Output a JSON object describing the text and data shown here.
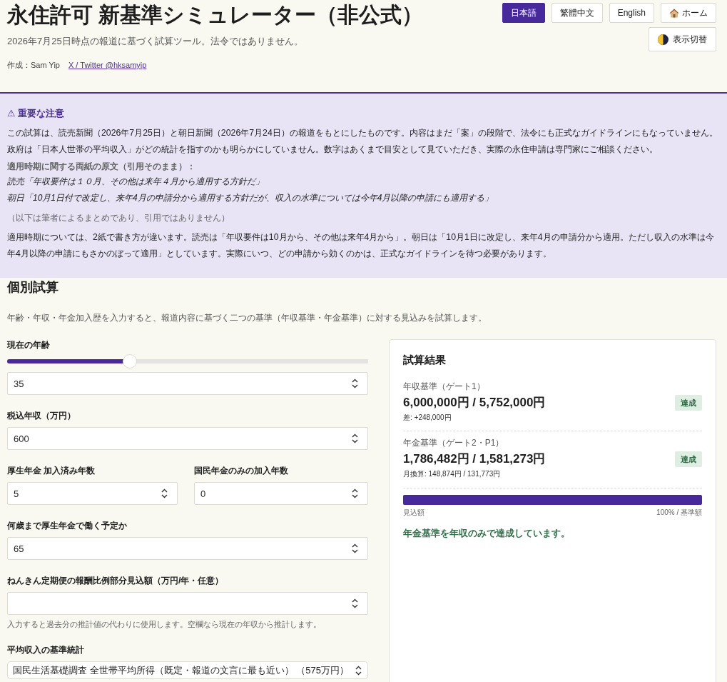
{
  "header": {
    "title": "永住許可 新基準シミュレーター（非公式）",
    "subtitle": "2026年7月25日時点の報道に基づく試算ツール。法令ではありません。",
    "author": "作成：Sam Yip",
    "link": "X / Twitter @hksamyip",
    "languages": [
      {
        "label": "日本語",
        "selected": true
      },
      {
        "label": "繁體中文",
        "selected": false
      },
      {
        "label": "English",
        "selected": false
      }
    ],
    "home_button": {
      "label": "ホーム"
    },
    "theme_button": {
      "label": "表示切替"
    }
  },
  "notice": {
    "title": "⚠ 重要な注意",
    "paragraph": "この試算は、読売新聞（2026年7月25日）と朝日新聞（2026年7月24日）の報道をもとにしたものです。内容はまだ「案」の段階で、法令にも正式なガイドラインにもなっていません。政府は「日本人世帯の平均収入」がどの統計を指すのかも明らかにしていません。数字はあくまで目安として見ていただき、実際の永住申請は専門家にご相談ください。",
    "quotes_heading": "適用時期に関する両紙の原文（引用そのまま）：",
    "quotes": [
      "読売「年収要件は１０月、その他は来年４月から適用する方針だ」",
      "朝日「10月1日付で改定し、来年4月の申請分から適用する方針だが、収入の水準については今年4月以降の申請にも適用する」"
    ],
    "summary_note": "（以下は筆者によるまとめであり、引用ではありません）",
    "summary": "適用時期については、2紙で書き方が違います。読売は「年収要件は10月から、その他は来年4月から」。朝日は「10月1日に改定し、来年4月の申請分から適用。ただし収入の水準は今年4月以降の申請にもさかのぼって適用」としています。実際にいつ、どの申請から効くのかは、正式なガイドラインを待つ必要があります。"
  },
  "calculator": {
    "title": "個別試算",
    "description": "年齢・年収・年金加入歴を入力すると、報道内容に基づく二つの基準（年収基準・年金基準）に対する見込みを試算します。",
    "form": [
      {
        "kind": "slider",
        "label": "現在の年齢",
        "level": 0.34,
        "value": "35"
      },
      {
        "kind": "number",
        "label": "税込年収（万円）",
        "value": "600"
      },
      {
        "kind": "pair",
        "fields": [
          {
            "label": "厚生年金 加入済み年数",
            "value": "5"
          },
          {
            "label": "国民年金のみの加入年数",
            "value": "0"
          }
        ]
      },
      {
        "kind": "number",
        "label": "何歳まで厚生年金で働く予定か",
        "value": "65"
      },
      {
        "kind": "number",
        "label": "ねんきん定期便の報酬比例部分見込額（万円/年・任意）",
        "hint": "入力すると過去分の推計値の代わりに使用します。空欄なら現在の年収から推計します。"
      },
      {
        "kind": "select",
        "label": "平均収入の基準統計",
        "value": "国民生活基礎調査 全世帯平均所得（既定・報道の文言に最も近い） （575万円）"
      }
    ],
    "result": {
      "title": "試算結果",
      "gates": [
        {
          "label": "年収基準（ゲート1）",
          "amount": "6,000,000円 / 5,752,000円",
          "badge": "達成",
          "passed": true,
          "note": "差: +248,000円"
        },
        {
          "label": "年金基準（ゲート2・P1）",
          "amount": "1,786,482円 / 1,581,273円",
          "badge": "達成",
          "passed": true,
          "note": "月換算: 148,874円 / 131,773円"
        }
      ],
      "progress": {
        "level": 1,
        "left_label": "見込額",
        "right_label": "100% / 基準額"
      },
      "message": "年金基準を年収のみで達成しています。"
    }
  }
}
